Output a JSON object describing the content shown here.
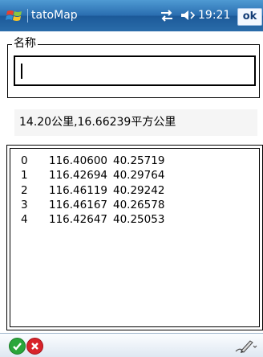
{
  "titlebar": {
    "title": "tatoMap",
    "clock": "19:21",
    "ok_label": "ok"
  },
  "form": {
    "name_label": "名称",
    "name_value": "",
    "info": "14.20公里,16.66239平方公里"
  },
  "points": [
    {
      "index": "0",
      "x": "116.40600",
      "y": "40.25719"
    },
    {
      "index": "1",
      "x": "116.42694",
      "y": "40.29764"
    },
    {
      "index": "2",
      "x": "116.46119",
      "y": "40.29242"
    },
    {
      "index": "3",
      "x": "116.46167",
      "y": "40.26578"
    },
    {
      "index": "4",
      "x": "116.42647",
      "y": "40.25053"
    }
  ],
  "icons": {
    "start": "windows-flag-icon",
    "network": "network-arrows-icon",
    "volume": "speaker-icon",
    "confirm": "green-check-icon",
    "cancel": "red-x-icon",
    "input_panel": "pen-input-icon"
  },
  "colors": {
    "titlebar": "#2b6fb1",
    "confirm": "#2aa63a",
    "cancel": "#d8232a"
  }
}
